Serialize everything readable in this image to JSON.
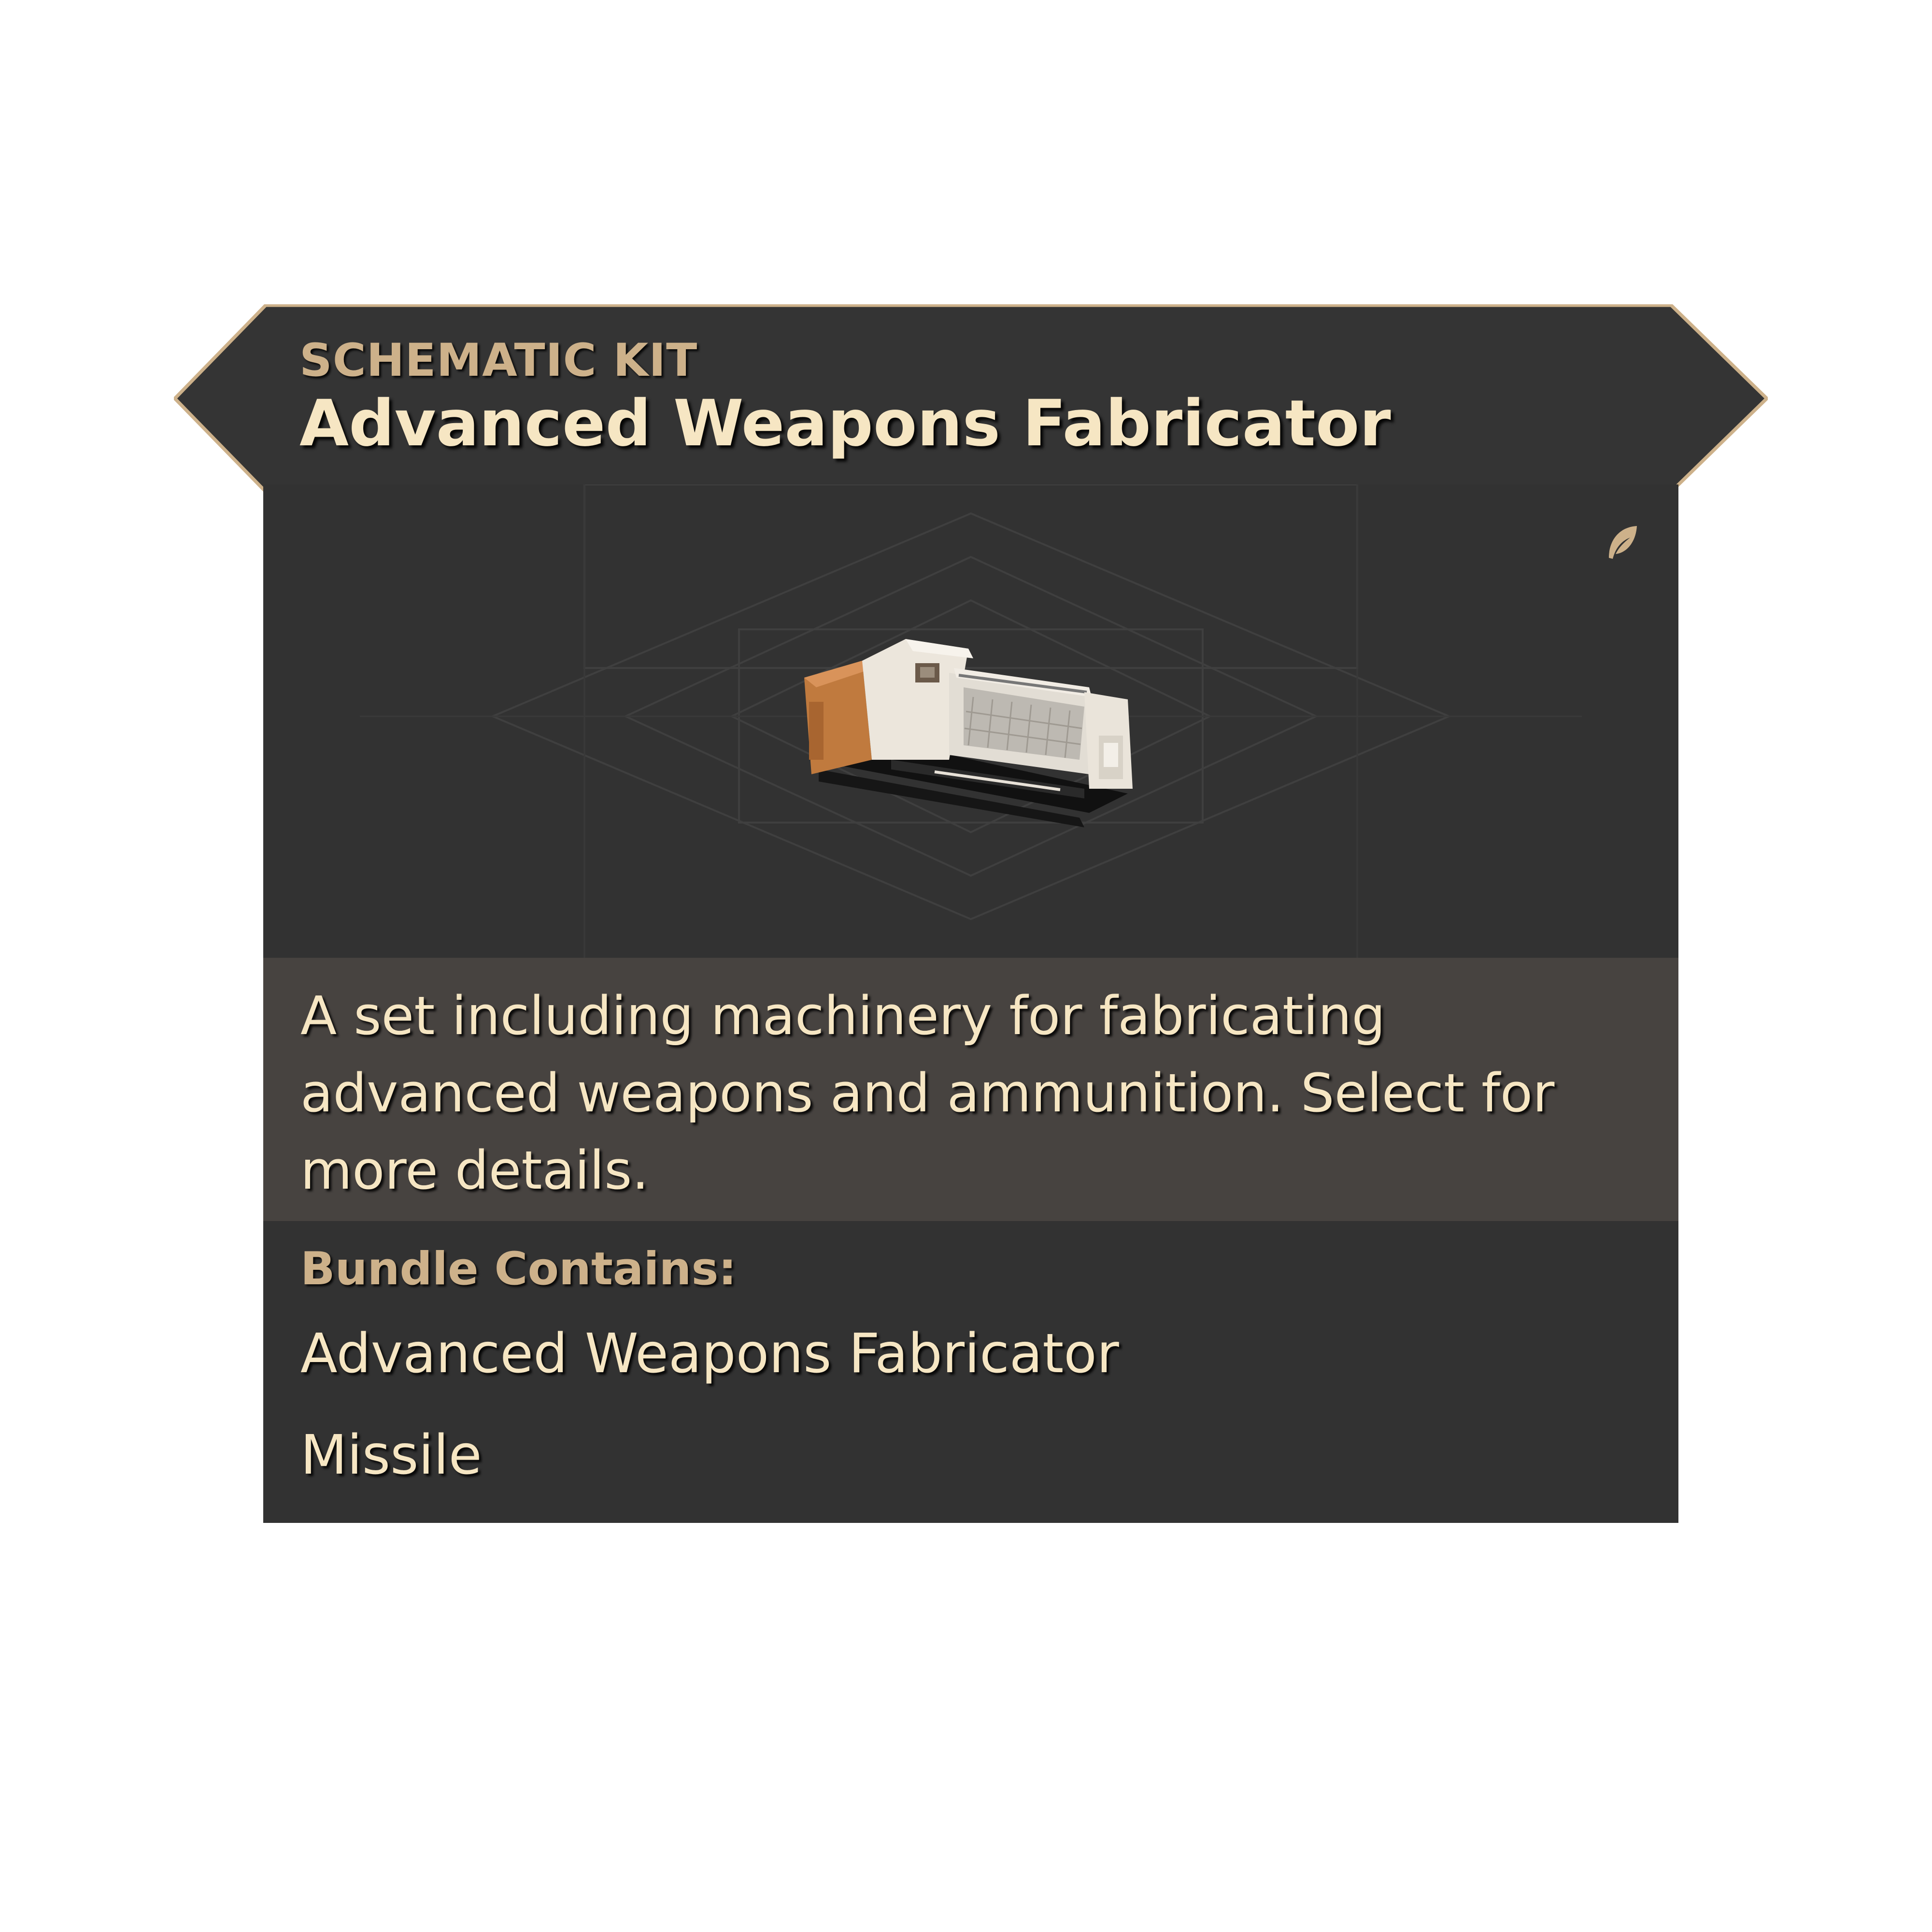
{
  "header": {
    "category": "SCHEMATIC KIT",
    "title": "Advanced Weapons Fabricator"
  },
  "preview": {
    "item_icon": "fabricator-machine-icon",
    "corner_icon": "leaf-icon"
  },
  "description": "A set including machinery for fabricating advanced weapons and ammunition. Select for more details.",
  "bundle": {
    "title": "Bundle Contains:",
    "items": [
      "Advanced Weapons Fabricator",
      "Missile"
    ]
  },
  "colors": {
    "panel_background": "#323232",
    "description_band": "#474340",
    "gold_border": "#cdb18a",
    "text_primary": "#f6e6c3",
    "text_accent": "#cdb18a"
  }
}
